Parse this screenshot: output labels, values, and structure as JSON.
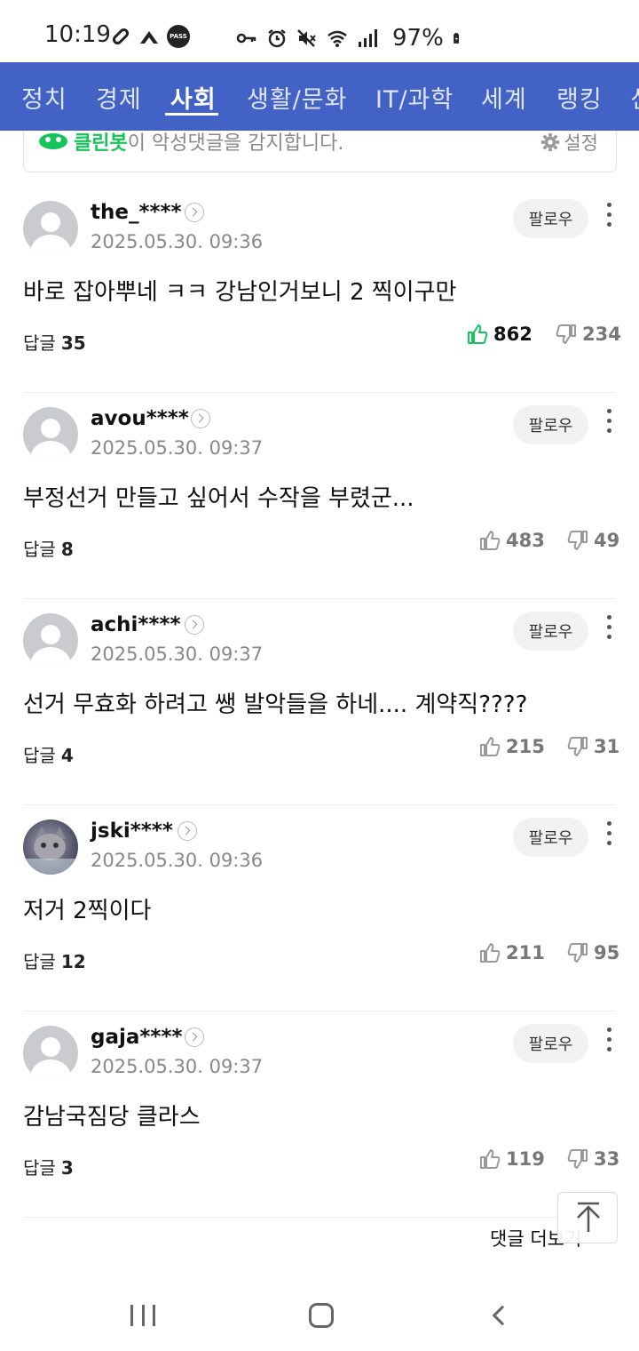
{
  "status_bar": {
    "time": "10:19",
    "left_icons": [
      "link-icon",
      "app-icon",
      "pass-icon"
    ],
    "pass_label": "PASS",
    "right_icons": [
      "key-icon",
      "alarm-icon",
      "mute-icon",
      "wifi-icon",
      "signal-icon",
      "battery-icon"
    ],
    "battery": "97%"
  },
  "tabs": [
    {
      "label": "정치"
    },
    {
      "label": "경제"
    },
    {
      "label": "사회"
    },
    {
      "label": "생활/문화"
    },
    {
      "label": "IT/과학"
    },
    {
      "label": "세계"
    },
    {
      "label": "랭킹"
    },
    {
      "label": "신"
    }
  ],
  "active_tab": "사회",
  "cleanbot": {
    "name": "클린봇",
    "text": "이 악성댓글을 감지합니다.",
    "settings": "설정"
  },
  "reply_label": "답글",
  "follow_label": "팔로우",
  "comments": [
    {
      "user": "the_****",
      "date": "2025.05.30. 09:36",
      "text": "바로 잡아뿌네 ㅋㅋ 강남인거보니 2 찍이구만",
      "replies": "35",
      "likes": "862",
      "dislikes": "234",
      "liked": true
    },
    {
      "user": "avou****",
      "date": "2025.05.30. 09:37",
      "text": "부정선거 만들고 싶어서 수작을 부렸군...",
      "replies": "8",
      "likes": "483",
      "dislikes": "49",
      "liked": false
    },
    {
      "user": "achi****",
      "date": "2025.05.30. 09:37",
      "text": "선거 무효화 하려고 쌩 발악들을 하네.... 계약직????",
      "replies": "4",
      "likes": "215",
      "dislikes": "31",
      "liked": false
    },
    {
      "user": "jski****",
      "date": "2025.05.30. 09:36",
      "text": "저거 2찍이다",
      "replies": "12",
      "likes": "211",
      "dislikes": "95",
      "liked": false
    },
    {
      "user": "gaja****",
      "date": "2025.05.30. 09:37",
      "text": "감남국짐당 클라스",
      "replies": "3",
      "likes": "119",
      "dislikes": "33",
      "liked": false
    }
  ],
  "more_comments": "댓글 더보기",
  "colors": {
    "tab_bar": "#4262c6",
    "like_active": "#16c45a",
    "cleanbot_green": "#16c45a"
  }
}
